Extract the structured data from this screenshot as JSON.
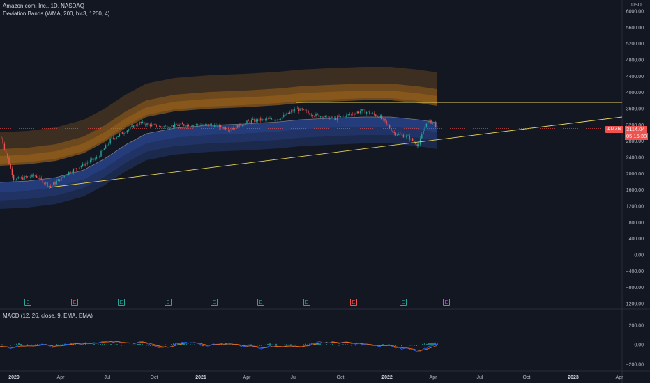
{
  "header": {
    "title": "Amazon.com, Inc., 1D, NASDAQ",
    "indicator": "Deviation Bands (WMA, 200, hlc3, 1200, 4)",
    "currency": "USD"
  },
  "price_axis": {
    "labels": [
      "6000.00",
      "5600.00",
      "5200.00",
      "4800.00",
      "4400.00",
      "4000.00",
      "3600.00",
      "3200.00",
      "2800.00",
      "2400.00",
      "2000.00",
      "1600.00",
      "1200.00",
      "800.00",
      "400.00",
      "0.00",
      "−400.00",
      "−800.00",
      "−1200.00"
    ],
    "values": [
      6000,
      5600,
      5200,
      4800,
      4400,
      4000,
      3600,
      3200,
      2800,
      2400,
      2000,
      1600,
      1200,
      800,
      400,
      0,
      -400,
      -800,
      -1200
    ]
  },
  "macd": {
    "label": "MACD (12, 26, close, 9, EMA, EMA)",
    "axis_labels": [
      "200.00",
      "0.00",
      "−200.00"
    ],
    "axis_values": [
      200,
      0,
      -200
    ]
  },
  "time_axis": {
    "labels": [
      "2020",
      "Apr",
      "Jul",
      "Oct",
      "2021",
      "Apr",
      "Jul",
      "Oct",
      "2022",
      "Apr",
      "Jul",
      "Oct",
      "2023",
      "Apr"
    ],
    "bold": [
      true,
      false,
      false,
      false,
      true,
      false,
      false,
      false,
      true,
      false,
      false,
      false,
      true,
      false
    ]
  },
  "last_price": {
    "symbol": "AMZN",
    "price": "3114.04",
    "countdown": "05:15:38",
    "value": 3114.04,
    "color": "#ef5350"
  },
  "events": [
    {
      "label": "E",
      "type": "green"
    },
    {
      "label": "E",
      "type": "red"
    },
    {
      "label": "E",
      "type": "green"
    },
    {
      "label": "E",
      "type": "green"
    },
    {
      "label": "E",
      "type": "green"
    },
    {
      "label": "E",
      "type": "green"
    },
    {
      "label": "E",
      "type": "green"
    },
    {
      "label": "E",
      "type": "red"
    },
    {
      "label": "E",
      "type": "green"
    },
    {
      "label": "E",
      "type": "purple"
    }
  ],
  "colors": {
    "background": "#131722",
    "upper_band": "#b8721a",
    "lower_band": "#2c4a9a",
    "trendline": "#e6d35a",
    "up": "#26a69a",
    "down": "#ef5350"
  }
}
